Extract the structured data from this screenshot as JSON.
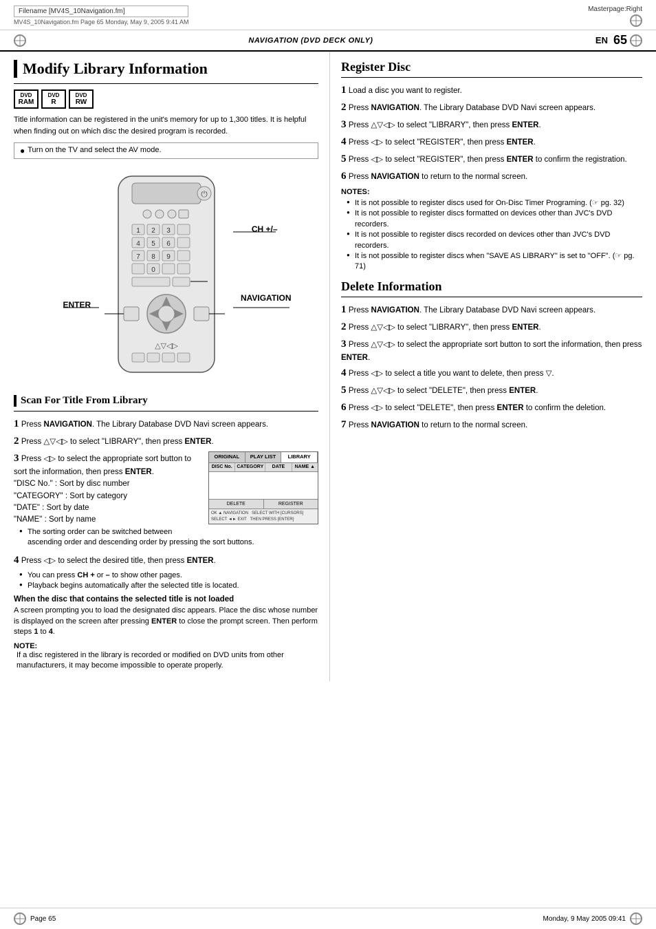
{
  "header": {
    "filename": "Filename [MV4S_10Navigation.fm]",
    "fm_line": "MV4S_10Navigation.fm  Page 65  Monday, May 9, 2005  9:41 AM",
    "masterpage": "Masterpage:Right"
  },
  "page_nav": {
    "section_label": "NAVIGATION (DVD DECK ONLY)",
    "en_label": "EN",
    "page_number": "65"
  },
  "left": {
    "section_title": "Modify Library Information",
    "dvd_badges": [
      {
        "top": "DVD",
        "bot": "RAM"
      },
      {
        "top": "DVD",
        "bot": "R"
      },
      {
        "top": "DVD",
        "bot": "RW"
      }
    ],
    "intro_text": "Title information can be registered in the unit's memory for up to 1,300 titles. It is helpful when finding out on which disc the desired program is recorded.",
    "note_box": "Turn on the TV and select the AV mode.",
    "ch_label": "CH +/–",
    "navigation_label": "NAVIGATION",
    "enter_label": "ENTER",
    "sub_section_title": "Scan For Title From Library",
    "steps": [
      {
        "num": "1",
        "text": "Press ",
        "bold_part": "NAVIGATION",
        "rest": ". The Library Database DVD Navi screen appears."
      },
      {
        "num": "2",
        "text": "Press △▽◁▷ to select \"LIBRARY\", then press ",
        "bold_part": "ENTER",
        "rest": "."
      },
      {
        "num": "3",
        "text": "Press ◁▷ to select the appropriate sort button to sort the information, then press ",
        "bold_part": "ENTER",
        "rest": "."
      }
    ],
    "step3_details": [
      "\"DISC No.\" : Sort by disc number",
      "\"CATEGORY\" : Sort by category",
      "\"DATE\" : Sort by date",
      "\"NAME\" : Sort by name"
    ],
    "step3_bullet": "The sorting order can be switched between ascending order and descending order by pressing the sort buttons.",
    "step4": {
      "num": "4",
      "text": "Press ◁▷ to select the desired title, then press ",
      "bold_part": "ENTER",
      "rest": "."
    },
    "step4_bullets": [
      "You can press CH + or – to show other pages.",
      "Playback begins automatically after the selected title is located."
    ],
    "bold_section_title": "When the disc that contains the selected title is not loaded",
    "bold_section_text": "A screen prompting you to load the designated disc appears. Place the disc whose number is displayed on the screen after pressing ENTER to close the prompt screen. Then perform steps 1 to 4.",
    "bold_section_bold_words": [
      "ENTER",
      "1",
      "4"
    ],
    "note_label": "NOTE:",
    "note_text": "If a disc registered in the library is recorded or modified on DVD units from other manufacturers, it may become impossible to operate properly."
  },
  "right": {
    "section_title": "Register Disc",
    "divider": true,
    "steps": [
      {
        "num": "1",
        "text": "Load a disc you want to register."
      },
      {
        "num": "2",
        "text": "Press NAVIGATION. The Library Database DVD Navi screen appears.",
        "bold": "NAVIGATION"
      },
      {
        "num": "3",
        "text": "Press △▽◁▷ to select \"LIBRARY\", then press ENTER.",
        "bold": "ENTER"
      },
      {
        "num": "4",
        "text": "Press ◁▷ to select \"REGISTER\", then press ENTER.",
        "bold": "ENTER"
      },
      {
        "num": "5",
        "text": "Press ◁▷ to select \"REGISTER\", then press ENTER to confirm the registration.",
        "bold": "ENTER"
      },
      {
        "num": "6",
        "text": "Press NAVIGATION to return to the normal screen.",
        "bold": "NAVIGATION"
      }
    ],
    "notes_label": "NOTES:",
    "notes": [
      "It is not possible to register discs used for On-Disc Timer Programing. (☞ pg. 32)",
      "It is not possible to register discs formatted on devices other than JVC's DVD recorders.",
      "It is not possible to register discs recorded on devices other than JVC's DVD recorders.",
      "It is not possible to register discs when \"SAVE AS LIBRARY\" is set to \"OFF\". (☞ pg. 71)"
    ],
    "delete_section_title": "Delete Information",
    "delete_steps": [
      {
        "num": "1",
        "text": "Press NAVIGATION. The Library Database DVD Navi screen appears.",
        "bold": "NAVIGATION"
      },
      {
        "num": "2",
        "text": "Press △▽◁▷ to select \"LIBRARY\", then press ENTER.",
        "bold": "ENTER"
      },
      {
        "num": "3",
        "text": "Press △▽◁▷ to select the appropriate sort button to sort the information, then press ENTER.",
        "bold": "ENTER"
      },
      {
        "num": "4",
        "text": "Press ◁▷ to select a title you want to delete, then press ▽.",
        "bold": ""
      },
      {
        "num": "5",
        "text": "Press △▽◁▷ to select \"DELETE\", then press ENTER.",
        "bold": "ENTER"
      },
      {
        "num": "6",
        "text": "Press ◁▷ to select \"DELETE\", then press ENTER to confirm the deletion.",
        "bold": "ENTER"
      },
      {
        "num": "7",
        "text": "Press NAVIGATION to return to the normal screen.",
        "bold": "NAVIGATION"
      }
    ]
  },
  "footer": {
    "left": "Page 65",
    "right": "Monday, 9 May 2005  09:41"
  },
  "screen_thumb": {
    "tabs": [
      "ORIGINAL",
      "PLAY LIST",
      "LIBRARY"
    ],
    "headers": [
      "DISC No.",
      "CATEGORY",
      "DATE",
      "NAME"
    ],
    "buttons": [
      "DELETE",
      "REGISTER"
    ],
    "nav_hint": "OK ▲ NAVIGATION  SELECT WITH [CURSORS]\nSELECT ◄► EXIT  THEN PRESS [ENTER]"
  }
}
